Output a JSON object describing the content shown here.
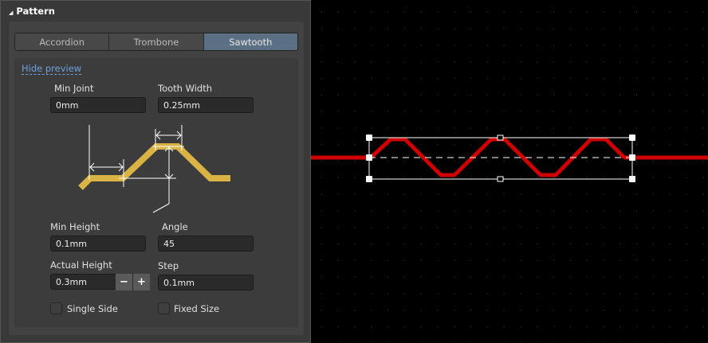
{
  "panel": {
    "section_title": "Pattern",
    "tabs": [
      {
        "label": "Accordion"
      },
      {
        "label": "Trombone"
      },
      {
        "label": "Sawtooth"
      }
    ],
    "hide_preview": "Hide preview",
    "min_joint": {
      "label": "Min Joint",
      "value": "0mm"
    },
    "tooth_width": {
      "label": "Tooth Width",
      "value": "0.25mm"
    },
    "min_height": {
      "label": "Min Height",
      "value": "0.1mm"
    },
    "angle": {
      "label": "Angle",
      "value": "45"
    },
    "actual_height": {
      "label": "Actual Height",
      "value": "0.3mm",
      "minus": "−",
      "plus": "+"
    },
    "step": {
      "label": "Step",
      "value": "0.1mm"
    },
    "single_side": {
      "label": "Single Side",
      "checked": false
    },
    "fixed_size": {
      "label": "Fixed Size",
      "checked": false
    }
  },
  "colors": {
    "trace": "#d00000",
    "preview_track": "#d9b444",
    "active_tab": "#5c7085",
    "link": "#6fa0d8"
  }
}
